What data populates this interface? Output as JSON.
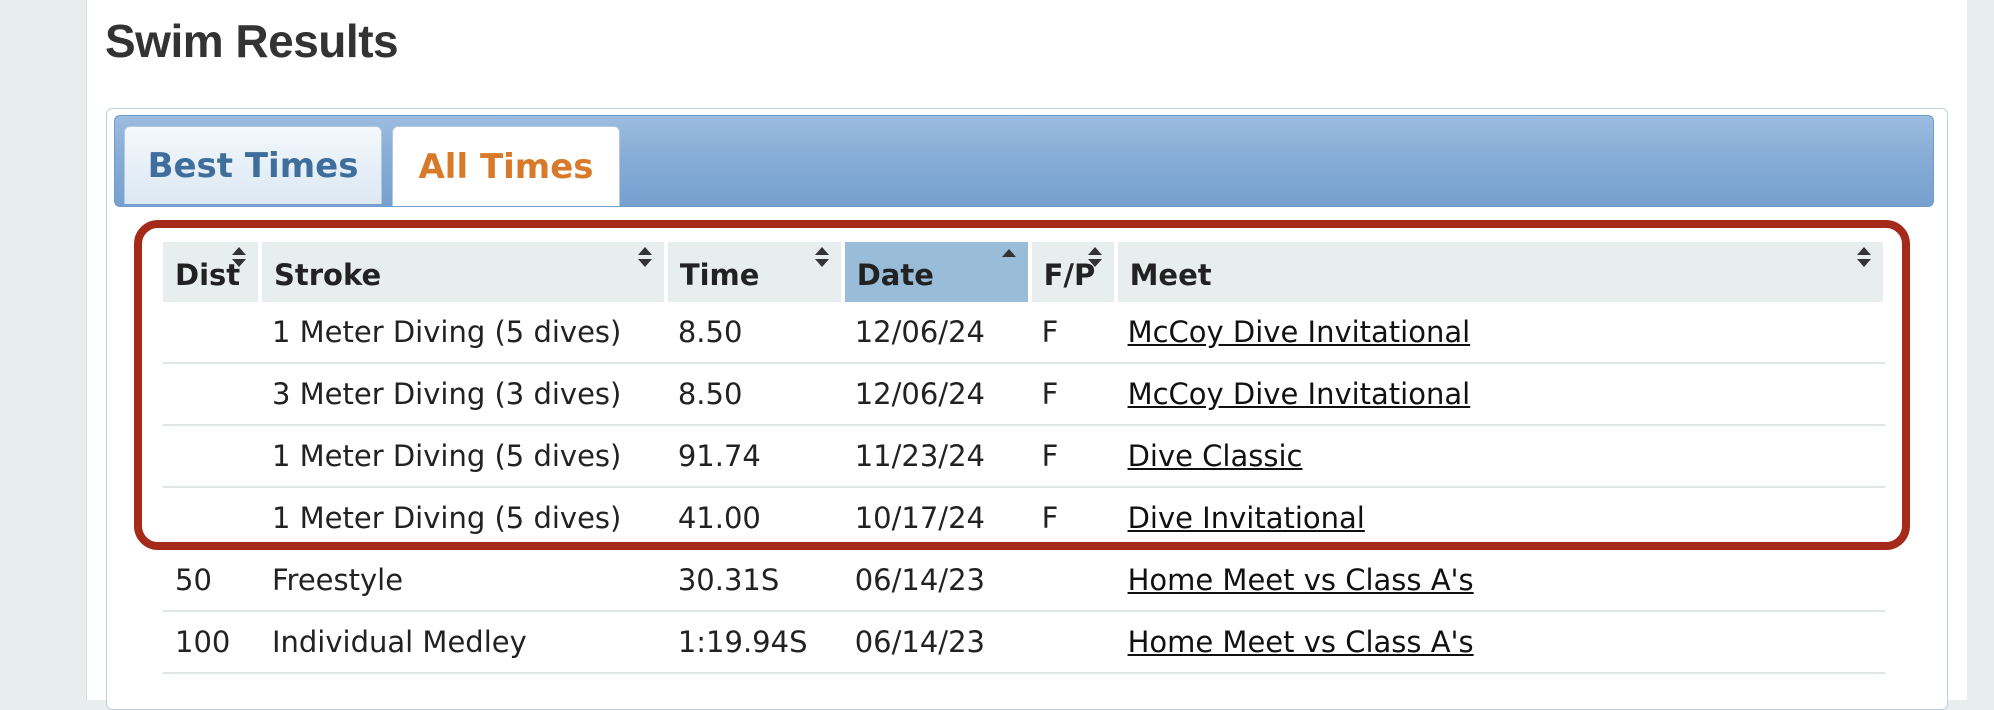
{
  "page": {
    "title": "Swim Results"
  },
  "tabs": [
    {
      "label": "Best Times",
      "active": false
    },
    {
      "label": "All Times",
      "active": true
    }
  ],
  "table": {
    "columns": [
      "Dist",
      "Stroke",
      "Time",
      "Date",
      "F/P",
      "Meet"
    ],
    "sorted_column": "Date",
    "rows": [
      {
        "dist": "",
        "stroke": "1 Meter Diving (5 dives)",
        "time": "8.50",
        "date": "12/06/24",
        "fp": "F",
        "meet": "McCoy Dive Invitational"
      },
      {
        "dist": "",
        "stroke": "3 Meter Diving (3 dives)",
        "time": "8.50",
        "date": "12/06/24",
        "fp": "F",
        "meet": "McCoy Dive Invitational"
      },
      {
        "dist": "",
        "stroke": "1 Meter Diving (5 dives)",
        "time": "91.74",
        "date": "11/23/24",
        "fp": "F",
        "meet": "Dive Classic"
      },
      {
        "dist": "",
        "stroke": "1 Meter Diving (5 dives)",
        "time": "41.00",
        "date": "10/17/24",
        "fp": "F",
        "meet": "Dive Invitational"
      },
      {
        "dist": "50",
        "stroke": "Freestyle",
        "time": "30.31S",
        "date": "06/14/23",
        "fp": "",
        "meet": "Home Meet vs Class A's"
      },
      {
        "dist": "100",
        "stroke": "Individual Medley",
        "time": "1:19.94S",
        "date": "06/14/23",
        "fp": "",
        "meet": "Home Meet vs Class A's"
      }
    ]
  },
  "colors": {
    "highlight_border": "#a52a1a",
    "active_tab_text": "#d87a2a",
    "inactive_tab_text": "#3e6e9c",
    "sorted_header": "#99bdd9"
  }
}
